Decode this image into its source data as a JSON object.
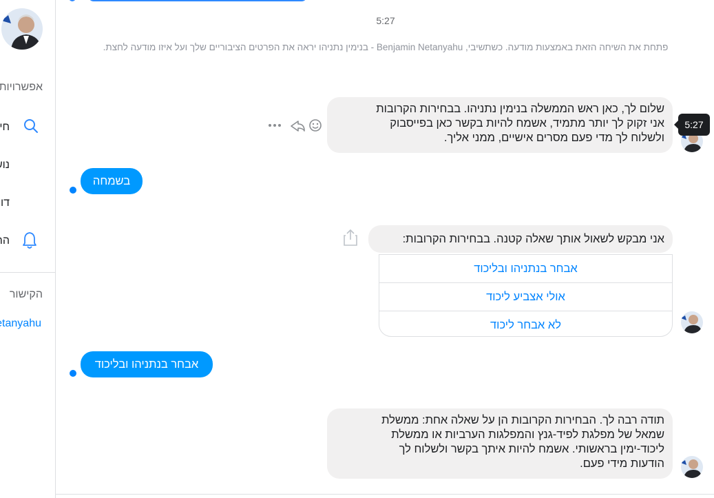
{
  "sidebar": {
    "options_label": "אפשרויות",
    "search_label": "חיפוש בשיחה",
    "item_2": "נושא",
    "item_3": "דוח",
    "notifications_label": "התראות",
    "links_label": "הקישור",
    "profile_link": "Benjamin Netanyahu"
  },
  "conversation": {
    "timestamp": "5:27",
    "notice": "פתחת את השיחה הזאת באמצעות מודעה. כשתשיבי, Benjamin Netanyahu - בנימין נתניהו יראה את הפרטים הציבוריים שלך ועל איזו מודעה לחצת.",
    "tooltip_time": "5:27",
    "messages": {
      "msg1_line1": "שלום לך, כאן ראש הממשלה בנימין נתניהו. בבחירות הקרובות",
      "msg1_line2": "אני זקוק לך יותר מתמיד, אשמח להיות בקשר כאן בפייסבוק",
      "msg1_line3": "ולשלוח לך מדי פעם מסרים אישיים, ממני אליך.",
      "reply1": "בשמחה",
      "msg2": "אני מבקש לשאול אותך שאלה קטנה. בבחירות הקרובות:",
      "reply2": "אבחר בנתניהו ובליכוד",
      "msg3_line1": "תודה רבה לך. הבחירות הקרובות הן על שאלה אחת: ממשלת",
      "msg3_line2": "שמאל של מפלגת לפיד-גנץ והמפלגות הערביות או ממשלת",
      "msg3_line3": "ליכוד-ימין בראשותי. אשמח להיות איתך בקשר ולשלוח לך",
      "msg3_line4": "הודעות מידי פעם."
    },
    "quick_replies": [
      "אבחר בנתניהו ובליכוד",
      "אולי אצביע ליכוד",
      "לא אבחר ליכוד"
    ]
  },
  "colors": {
    "accent": "#0099ff",
    "incoming_bubble": "#f1f0f0",
    "link": "#0084ff"
  },
  "icons": [
    "search-icon",
    "bell-icon",
    "share-icon",
    "emoji-icon",
    "reply-icon",
    "more-icon",
    "avatar"
  ]
}
